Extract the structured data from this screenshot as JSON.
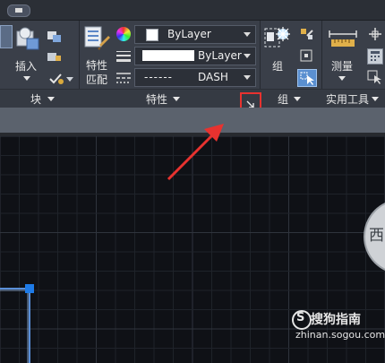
{
  "ribbon": {
    "block": {
      "insert_label": "插入",
      "panel_label": "块"
    },
    "properties": {
      "match_label_line1": "特性",
      "match_label_line2": "匹配",
      "color_value": "ByLayer",
      "lineweight_value": "ByLayer",
      "linetype_value": "DASH",
      "linetype_prefix": "------",
      "panel_label": "特性"
    },
    "group": {
      "group_label": "组",
      "panel_label": "组"
    },
    "utilities": {
      "measure_label": "测量",
      "panel_label": "实用工具"
    }
  },
  "viewcube": {
    "face_label": "西"
  },
  "watermark": {
    "brand": "搜狗指南",
    "url": "zhinan.sogou.com"
  },
  "colors": {
    "ribbon_bg": "#3a3f49",
    "canvas_bg": "#0f1116",
    "highlight_red": "#e8322f",
    "grip_blue": "#1e7be8"
  }
}
